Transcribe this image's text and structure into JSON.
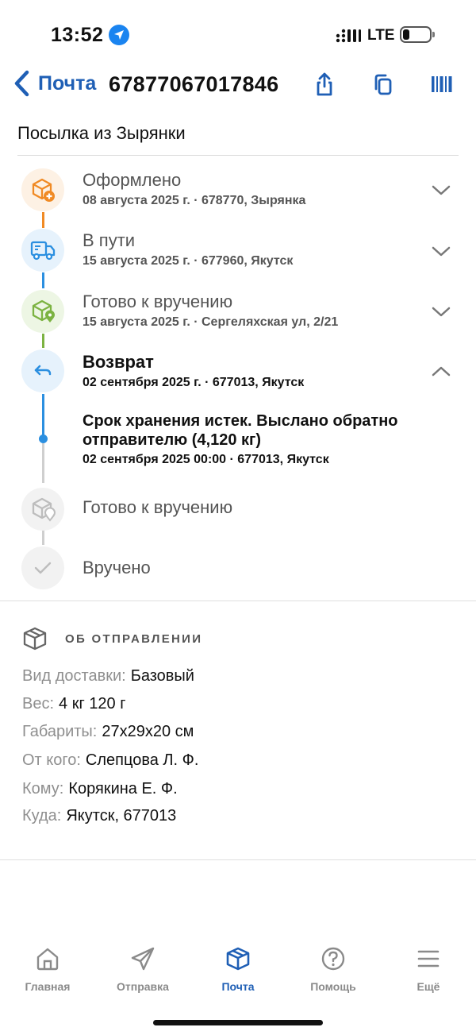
{
  "status_bar": {
    "time": "13:52",
    "network": "LTE"
  },
  "header": {
    "back_label": "Почта",
    "track_number": "67877067017846",
    "icons": [
      "share-icon",
      "copy-icon",
      "barcode-icon"
    ]
  },
  "subtitle": "Посылка из Зырянки",
  "timeline": [
    {
      "title": "Оформлено",
      "sub": "08 августа 2025 г. · 678770, Зырянка",
      "icon": "box-plus-icon",
      "color": "#f08a24",
      "state": "collapsed"
    },
    {
      "title": "В пути",
      "sub": "15 августа 2025 г. · 677960, Якутск",
      "icon": "truck-icon",
      "color": "#2b8fe0",
      "state": "collapsed"
    },
    {
      "title": "Готово к вручению",
      "sub": "15 августа 2025 г. · Сергеляхская ул, 2/21",
      "icon": "box-location-icon",
      "color": "#7cb342",
      "state": "collapsed"
    },
    {
      "title": "Возврат",
      "sub": "02 сентября 2025 г. · 677013, Якутск",
      "icon": "return-arrow-icon",
      "color": "#2b8fe0",
      "state": "expanded"
    },
    {
      "title": "Готово к вручению",
      "icon": "box-location-icon",
      "color": "#bdbdbd",
      "state": "pending"
    },
    {
      "title": "Вручено",
      "icon": "check-icon",
      "color": "#bdbdbd",
      "state": "pending"
    }
  ],
  "return_event": {
    "title": "Срок хранения истек. Выслано обратно отправителю (4,120 кг)",
    "sub": "02 сентября 2025 00:00 · 677013, Якутск"
  },
  "about": {
    "header": "ОБ ОТПРАВЛЕНИИ",
    "rows": [
      {
        "label": "Вид доставки:",
        "value": "Базовый"
      },
      {
        "label": "Вес:",
        "value": "4 кг 120 г"
      },
      {
        "label": "Габариты:",
        "value": "27x29x20 см"
      },
      {
        "label": "От кого:",
        "value": "Слепцова Л. Ф."
      },
      {
        "label": "Кому:",
        "value": "Корякина Е. Ф."
      },
      {
        "label": "Куда:",
        "value": "Якутск, 677013"
      }
    ]
  },
  "bottom_nav": [
    {
      "label": "Главная",
      "icon": "home-icon",
      "active": false
    },
    {
      "label": "Отправка",
      "icon": "send-icon",
      "active": false
    },
    {
      "label": "Почта",
      "icon": "parcel-icon",
      "active": true
    },
    {
      "label": "Помощь",
      "icon": "help-icon",
      "active": false
    },
    {
      "label": "Ещё",
      "icon": "menu-icon",
      "active": false
    }
  ],
  "colors": {
    "accent": "#1f5fb5",
    "orange": "#f08a24",
    "blue": "#2b8fe0",
    "green": "#7cb342",
    "grey": "#bdbdbd"
  }
}
